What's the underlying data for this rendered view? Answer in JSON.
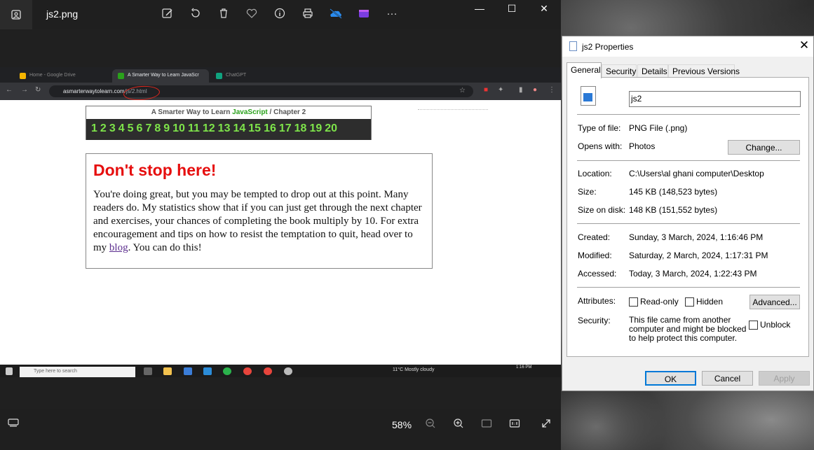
{
  "photos": {
    "filename": "js2.png",
    "tools": [
      "edit-image-icon",
      "rotate-icon",
      "delete-icon",
      "favorite-icon",
      "info-icon",
      "print-icon",
      "onedrive-icon",
      "clipchamp-icon",
      "more-icon"
    ],
    "more_glyph": "···",
    "zoom": "58%",
    "window_controls": {
      "minimize": "—",
      "maximize": "☐",
      "close": "✕"
    }
  },
  "browser": {
    "tabs": [
      {
        "label": "Home - Google Drive",
        "active": false
      },
      {
        "label": "A Smarter Way to Learn JavaScr",
        "active": true
      },
      {
        "label": "ChatGPT",
        "active": false
      }
    ],
    "url_domain": "asmarterwaytolearn.com",
    "url_path": "/js/2.html"
  },
  "book": {
    "title_prefix": "A Smarter Way to Learn",
    "title_js": "JavaScript",
    "title_sep": "/",
    "title_chapter": "Chapter 2",
    "chapters": [
      "1",
      "2",
      "3",
      "4",
      "5",
      "6",
      "7",
      "8",
      "9",
      "10",
      "11",
      "12",
      "13",
      "14",
      "15",
      "16",
      "17",
      "18",
      "19",
      "20"
    ]
  },
  "callout": {
    "heading": "Don't stop here!",
    "text_before": "You're doing great, but you may be tempted to drop out at this point. Many readers do. My statistics show that if you can just get through the next chapter and exercises, your chances of completing the book multiply by 10. For extra encouragement and tips on how to resist the temptation to quit, head over to my ",
    "link": "blog",
    "text_after": ". You can do this!"
  },
  "taskbar": {
    "search_placeholder": "Type here to search",
    "weather": "11°C  Mostly cloudy",
    "time": "1:16 PM"
  },
  "properties": {
    "title": "js2 Properties",
    "tabs": [
      "General",
      "Security",
      "Details",
      "Previous Versions"
    ],
    "active_tab": "General",
    "file_name": "js2",
    "type_label": "Type of file:",
    "type_value": "PNG File (.png)",
    "opens_label": "Opens with:",
    "opens_value": "Photos",
    "change_btn": "Change...",
    "location_label": "Location:",
    "location_value": "C:\\Users\\al ghani computer\\Desktop",
    "size_label": "Size:",
    "size_value": "145 KB (148,523 bytes)",
    "size_disk_label": "Size on disk:",
    "size_disk_value": "148 KB (151,552 bytes)",
    "created_label": "Created:",
    "created_value": "Sunday, 3 March, 2024, 1:16:46 PM",
    "modified_label": "Modified:",
    "modified_value": "Saturday, 2 March, 2024, 1:17:31 PM",
    "accessed_label": "Accessed:",
    "accessed_value": "Today, 3 March, 2024, 1:22:43 PM",
    "attributes_label": "Attributes:",
    "readonly_label": "Read-only",
    "hidden_label": "Hidden",
    "advanced_btn": "Advanced...",
    "security_label": "Security:",
    "security_text": "This file came from another computer and might be blocked to help protect this computer.",
    "unblock_label": "Unblock",
    "ok_btn": "OK",
    "cancel_btn": "Cancel",
    "apply_btn": "Apply"
  }
}
